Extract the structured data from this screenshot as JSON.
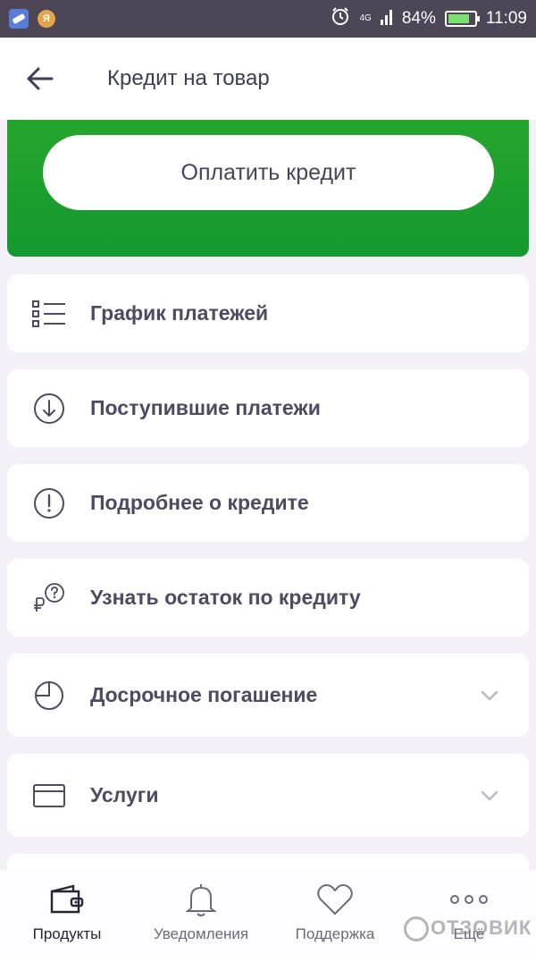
{
  "status_bar": {
    "network": "4G",
    "battery": "84%",
    "battery_level": 0.84,
    "time": "11:09",
    "icons": [
      "app-notification-icon",
      "app-notification-icon-2",
      "alarm-icon",
      "signal-icon",
      "battery-icon"
    ]
  },
  "app_bar": {
    "back_icon": "arrow-left-icon",
    "title": "Кредит на товар"
  },
  "banner": {
    "color": "#1a9e2f",
    "pay_button_label": "Оплатить кредит"
  },
  "menu": {
    "items": [
      {
        "label": "График платежей",
        "icon": "schedule-list-icon",
        "expandable": false
      },
      {
        "label": "Поступившие платежи",
        "icon": "arrow-down-circle-icon",
        "expandable": false
      },
      {
        "label": "Подробнее о кредите",
        "icon": "info-exclamation-icon",
        "expandable": false
      },
      {
        "label": "Узнать остаток по кредиту",
        "icon": "ruble-question-icon",
        "expandable": false
      },
      {
        "label": "Досрочное погашение",
        "icon": "pie-clock-icon",
        "expandable": true
      },
      {
        "label": "Услуги",
        "icon": "card-icon",
        "expandable": true
      }
    ]
  },
  "bottom_nav": {
    "items": [
      {
        "label": "Продукты",
        "icon": "wallet-icon",
        "active": true
      },
      {
        "label": "Уведомления",
        "icon": "bell-icon",
        "active": false
      },
      {
        "label": "Поддержка",
        "icon": "heart-icon",
        "active": false
      },
      {
        "label": "Ещё",
        "icon": "more-dots-icon",
        "active": false
      }
    ]
  },
  "watermark": "ОТЗОВИК"
}
